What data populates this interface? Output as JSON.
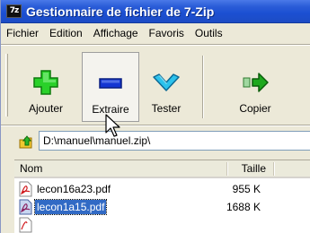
{
  "window": {
    "title": "Gestionnaire de fichier de 7-Zip",
    "app_icon_text": "7z"
  },
  "menu": [
    "Fichier",
    "Edition",
    "Affichage",
    "Favoris",
    "Outils"
  ],
  "toolbar": {
    "add_label": "Ajouter",
    "extract_label": "Extraire",
    "test_label": "Tester",
    "copy_label": "Copier"
  },
  "address": {
    "path": "D:\\manuel\\manuel.zip\\"
  },
  "list": {
    "columns": [
      "Nom",
      "Taille"
    ],
    "rows": [
      {
        "name": "lecon16a23.pdf",
        "size": "955 K",
        "selected": false
      },
      {
        "name": "lecon1a15.pdf",
        "size": "1688 K",
        "selected": true
      }
    ]
  },
  "colors": {
    "title_bar": "#1b4fd2",
    "add_icon": "#22cc22",
    "extract_icon": "#1030c8",
    "test_icon": "#22b8e8",
    "copy_icon": "#18a018",
    "selection": "#316ac5"
  },
  "icons": {
    "add": "plus-icon",
    "extract": "minus-icon",
    "test": "check-icon",
    "copy": "copy-arrow-icon",
    "up": "folder-up-icon",
    "file": "pdf-icon"
  }
}
